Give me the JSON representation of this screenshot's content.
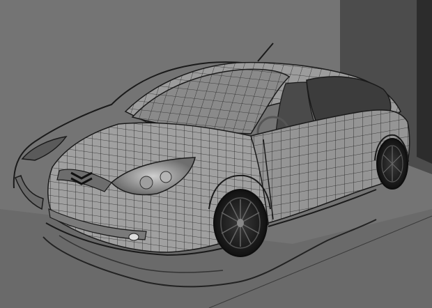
{
  "viewport": {
    "mode": "wireframe-on-shaded",
    "subject": "car-model"
  },
  "colors": {
    "background": "#747474",
    "back_wall": "#4c4c4c",
    "wall_shadow": "#2a2a2a",
    "floor": "#6b6b6b",
    "car_shaded": "#9a9a9a",
    "car_dark": "#7e7e7e",
    "wire": "#1e1e1e",
    "glass": "#3a3a3a",
    "reference_outline": "#1a1a1a"
  }
}
